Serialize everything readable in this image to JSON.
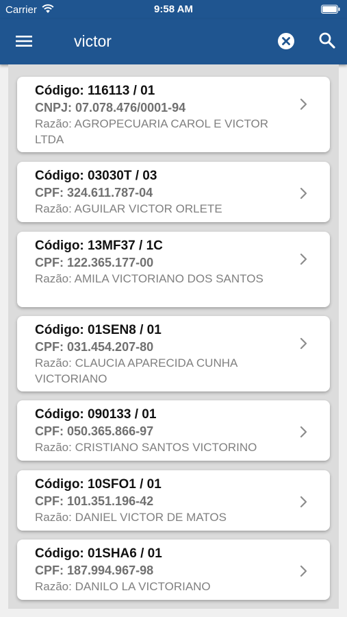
{
  "status_bar": {
    "carrier": "Carrier",
    "time": "9:58 AM"
  },
  "app_bar": {
    "search_value": "victor",
    "menu_icon": "hamburger-menu-icon",
    "clear_icon": "clear-circle-icon",
    "search_icon": "search-icon",
    "background_color": "#1f5590"
  },
  "results": [
    {
      "codigo": "Código: 116113 / 01",
      "documento": "CNPJ: 07.078.476/0001-94",
      "razao": "Razão: AGROPECUARIA CAROL E VICTOR LTDA"
    },
    {
      "codigo": "Código: 03030T / 03",
      "documento": "CPF: 324.611.787-04",
      "razao": "Razão: AGUILAR VICTOR ORLETE"
    },
    {
      "codigo": "Código: 13MF37 / 1C",
      "documento": "CPF: 122.365.177-00",
      "razao": "Razão: AMILA VICTORIANO DOS SANTOS"
    },
    {
      "codigo": "Código: 01SEN8 / 01",
      "documento": "CPF: 031.454.207-80",
      "razao": "Razão: CLAUCIA APARECIDA CUNHA VICTORIANO"
    },
    {
      "codigo": "Código: 090133 / 01",
      "documento": "CPF: 050.365.866-97",
      "razao": "Razão: CRISTIANO SANTOS VICTORINO"
    },
    {
      "codigo": "Código: 10SFO1 / 01",
      "documento": "CPF: 101.351.196-42",
      "razao": "Razão: DANIEL VICTOR DE MATOS"
    },
    {
      "codigo": "Código: 01SHA6 / 01",
      "documento": "CPF: 187.994.967-98",
      "razao": "Razão: DANILO LA VICTORIANO"
    }
  ]
}
